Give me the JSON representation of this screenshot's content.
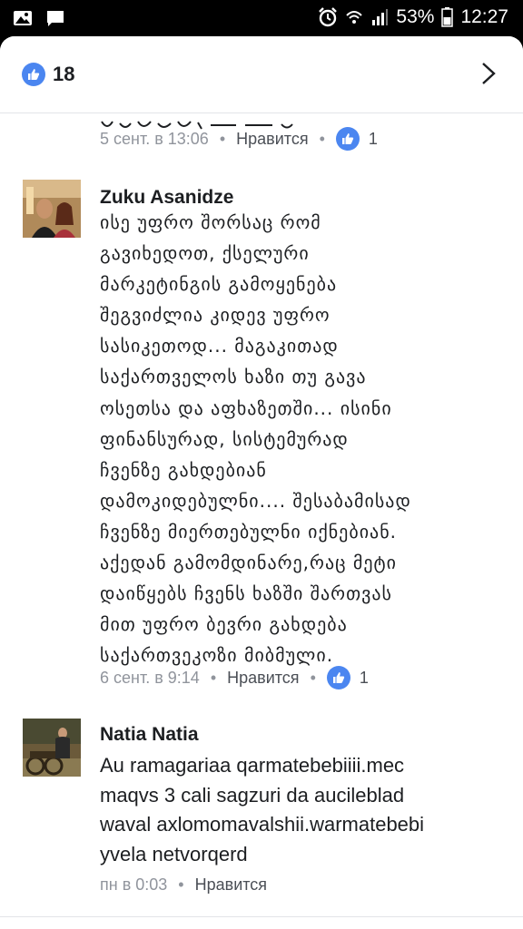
{
  "status_bar": {
    "icons_left": [
      "image-icon",
      "message-icon"
    ],
    "icons_right": [
      "alarm-icon",
      "wifi-icon",
      "signal-icon"
    ],
    "battery": "53%",
    "time": "12:27"
  },
  "header": {
    "like_count": "18",
    "icons": [
      "like-icon",
      "chevron-right-icon"
    ]
  },
  "comments": [
    {
      "time": "5 сент. в 13:06",
      "like_label": "Нравится",
      "likes": "1"
    },
    {
      "author": "Zuku Asanidze",
      "lines": [
        "ისე უფრო შორსაც რომ",
        "გავიხედოთ, ქსელური",
        "მარკეტინგის გამოყენება",
        "შეგვიძლია კიდევ უფრო",
        "სასიკეთოდ... მაგაკითად",
        "საქართველოს ხაზი თუ გავა",
        "ოსეთსა და აფხაზეთში... ისინი",
        "ფინანსურად, სისტემურად",
        "ჩვენზე გახდებიან",
        "დამოკიდებულნი.... შესაბამისად",
        "ჩვენზე მიერთებულნი იქნებიან.",
        "აქედან გამომდინარე,რაც მეტი",
        "დაიწყებს ჩვენს ხაზში შართვას",
        "მით უფრო ბევრი გახდება",
        "საქართვეკოზი მიბმული."
      ],
      "time": "6 сент. в 9:14",
      "like_label": "Нравится",
      "likes": "1"
    },
    {
      "author": "Natia Natia",
      "lines": [
        "Au ramagariaa qarmatebebiiii.mec",
        "maqvs 3 cali sagzuri da aucileblad",
        "waval axlomomavalshii.warmatebebi",
        "yvela netvorqerd"
      ],
      "time": "пн в 0:03",
      "like_label": "Нравится"
    }
  ],
  "colors": {
    "like_blue": "#4b86f0",
    "meta_gray": "#90949c",
    "text": "#1c1e21"
  }
}
